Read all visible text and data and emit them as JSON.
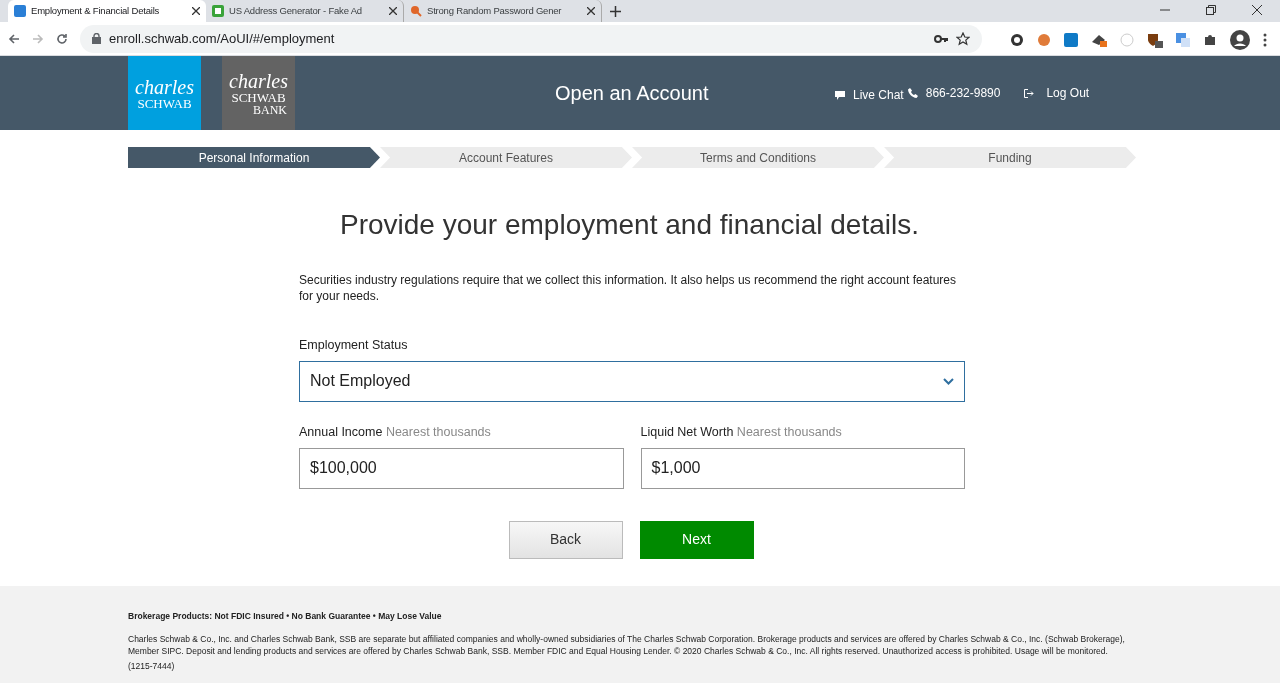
{
  "browser": {
    "tabs": [
      {
        "title": "Employment & Financial Details",
        "selected": true
      },
      {
        "title": "US Address Generator - Fake Ad",
        "selected": false
      },
      {
        "title": "Strong Random Password Gener",
        "selected": false
      }
    ],
    "url": "enroll.schwab.com/AoUI/#/employment"
  },
  "header": {
    "logos": [
      {
        "script": "charles",
        "name": "SCHWAB"
      },
      {
        "script": "charles",
        "name": "SCHWAB",
        "sub": "BANK"
      }
    ],
    "title": "Open an Account",
    "live_chat": "Live Chat",
    "phone": "866-232-9890",
    "logout": "Log Out"
  },
  "steps": [
    {
      "label": "Personal Information",
      "selected": true
    },
    {
      "label": "Account Features",
      "selected": false
    },
    {
      "label": "Terms and Conditions",
      "selected": false
    },
    {
      "label": "Funding",
      "selected": false
    }
  ],
  "form": {
    "heading": "Provide your employment and financial details.",
    "intro": "Securities industry regulations require that we collect this information. It also helps us recommend the right account features for your needs.",
    "employment_status": {
      "label": "Employment Status",
      "value": "Not Employed"
    },
    "fields": [
      {
        "label": "Annual Income",
        "hint": "Nearest thousands",
        "prefix": "$",
        "value": "100,000"
      },
      {
        "label": "Liquid Net Worth",
        "hint": "Nearest thousands",
        "prefix": "$",
        "value": "1,000"
      }
    ],
    "buttons": [
      {
        "label": "Back",
        "kind": "secondary"
      },
      {
        "label": "Next",
        "kind": "primary"
      }
    ]
  },
  "footer": {
    "disclosure": "Brokerage Products: Not FDIC Insured • No Bank Guarantee • May Lose Value",
    "legal": "Charles Schwab & Co., Inc. and Charles Schwab Bank, SSB are separate but affiliated companies and wholly-owned subsidiaries of The Charles Schwab Corporation. Brokerage products and services are offered by Charles Schwab & Co., Inc. (Schwab Brokerage), Member SIPC. Deposit and lending products and services are offered by Charles Schwab Bank, SSB. Member FDIC and Equal Housing Lender. © 2020 Charles Schwab & Co., Inc. All rights reserved. Unauthorized access is prohibited. Usage will be monitored.",
    "code": "(1215-7444)"
  }
}
